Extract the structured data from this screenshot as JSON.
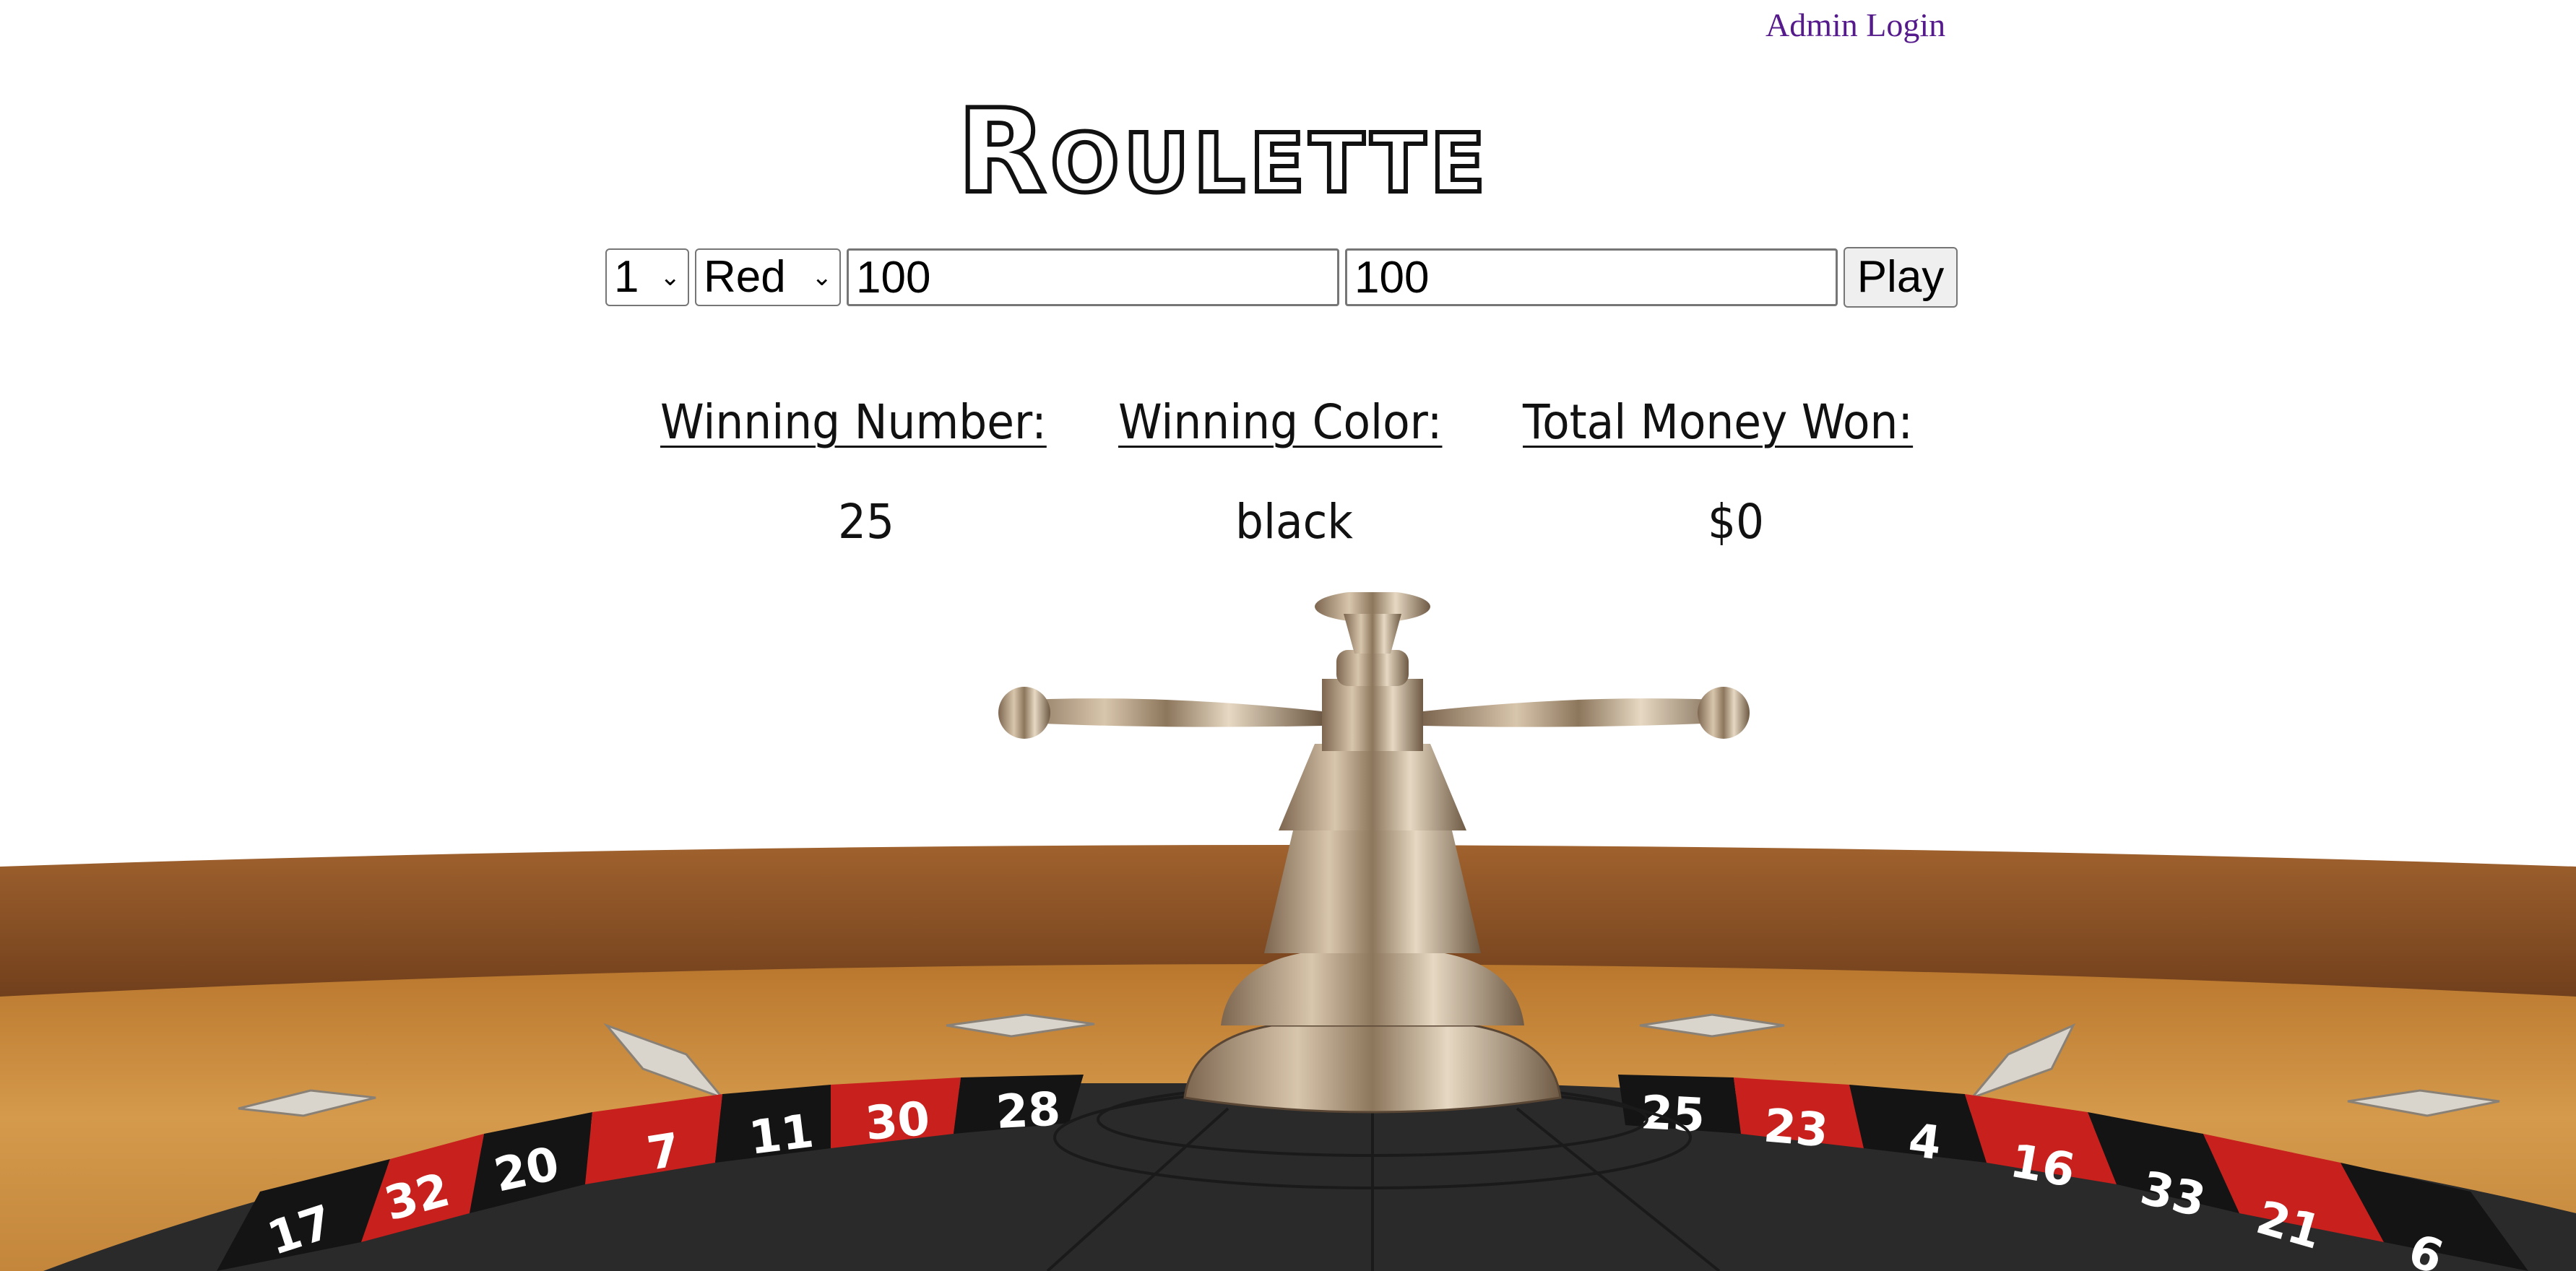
{
  "header": {
    "admin_login": "Admin Login",
    "title": "Roulette"
  },
  "bet_form": {
    "number_select": {
      "selected": "1"
    },
    "color_select": {
      "selected": "Red"
    },
    "input_1": {
      "value": "100"
    },
    "input_2": {
      "value": "100"
    },
    "play_label": "Play"
  },
  "results": {
    "winning_number_label": "Winning Number:",
    "winning_color_label": "Winning Color:",
    "total_money_label": "Total Money Won:",
    "winning_number": "25",
    "winning_color": "black",
    "total_money": "$0"
  },
  "wheel": {
    "left_pockets": [
      "17",
      "32",
      "20",
      "7",
      "11",
      "30",
      "28"
    ],
    "right_pockets": [
      "25",
      "23",
      "4",
      "16",
      "33",
      "21",
      "6"
    ],
    "colors": {
      "red": "#c8201c",
      "black": "#141414",
      "wood": "#c78a3a",
      "rim": "#6b3b1a",
      "chrome": "#b49a78"
    }
  }
}
